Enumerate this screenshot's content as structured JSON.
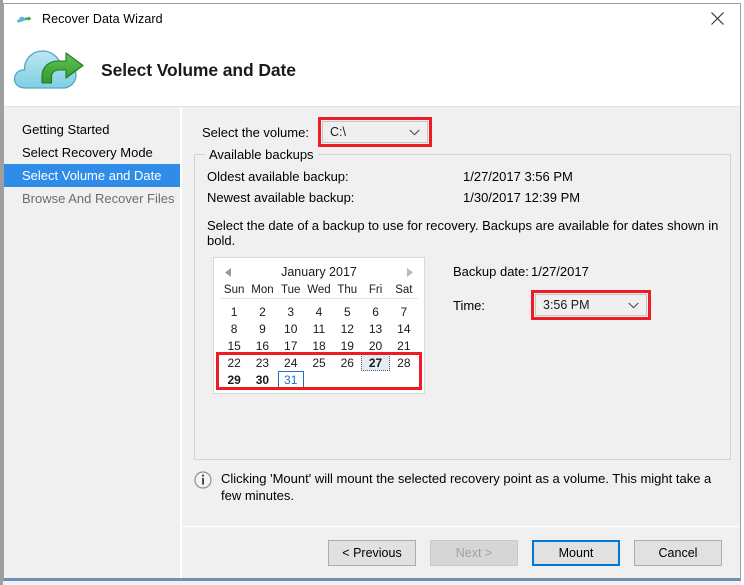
{
  "window": {
    "title": "Recover Data Wizard",
    "icon": "cloud-icon",
    "close_label": "×"
  },
  "banner": {
    "title": "Select Volume and Date",
    "icon": "cloud-recovery-icon"
  },
  "sidebar": {
    "items": [
      {
        "label": "Getting Started",
        "state": "normal"
      },
      {
        "label": "Select Recovery Mode",
        "state": "normal"
      },
      {
        "label": "Select Volume and Date",
        "state": "active"
      },
      {
        "label": "Browse And Recover Files",
        "state": "disabled"
      }
    ]
  },
  "volume": {
    "label": "Select the volume:",
    "selected": "C:\\",
    "options": [
      "C:\\"
    ],
    "highlight_color": "#ee1c25"
  },
  "available_backups": {
    "legend": "Available backups",
    "oldest_label": "Oldest available backup:",
    "oldest_value": "1/27/2017 3:56 PM",
    "newest_label": "Newest available backup:",
    "newest_value": "1/30/2017 12:39 PM",
    "instruction": "Select the date of a backup to use for recovery. Backups are available for dates shown in bold."
  },
  "calendar": {
    "month_title": "January 2017",
    "prev_arrow": "◄",
    "next_arrow": "►",
    "day_headers": [
      "Sun",
      "Mon",
      "Tue",
      "Wed",
      "Thu",
      "Fri",
      "Sat"
    ],
    "leading_blanks": 0,
    "days": [
      {
        "d": "1"
      },
      {
        "d": "2"
      },
      {
        "d": "3"
      },
      {
        "d": "4"
      },
      {
        "d": "5"
      },
      {
        "d": "6"
      },
      {
        "d": "7"
      },
      {
        "d": "8"
      },
      {
        "d": "9"
      },
      {
        "d": "10"
      },
      {
        "d": "11"
      },
      {
        "d": "12"
      },
      {
        "d": "13"
      },
      {
        "d": "14"
      },
      {
        "d": "15"
      },
      {
        "d": "16"
      },
      {
        "d": "17"
      },
      {
        "d": "18"
      },
      {
        "d": "19"
      },
      {
        "d": "20"
      },
      {
        "d": "21"
      },
      {
        "d": "22"
      },
      {
        "d": "23"
      },
      {
        "d": "24"
      },
      {
        "d": "25"
      },
      {
        "d": "26"
      },
      {
        "d": "27",
        "bold": true,
        "selected": true
      },
      {
        "d": "28"
      },
      {
        "d": "29",
        "bold": true
      },
      {
        "d": "30",
        "bold": true
      },
      {
        "d": "31",
        "today": true
      }
    ],
    "highlight_color": "#ee1c25"
  },
  "backup_date": {
    "label": "Backup date:",
    "value": "1/27/2017"
  },
  "time": {
    "label": "Time:",
    "selected": "3:56 PM",
    "options": [
      "3:56 PM"
    ],
    "highlight_color": "#ee1c25"
  },
  "note": {
    "icon": "info-icon",
    "text": "Clicking 'Mount' will mount the selected recovery point as a volume. This might take a few minutes."
  },
  "footer": {
    "previous_label": "< Previous",
    "next_label": "Next >",
    "mount_label": "Mount",
    "cancel_label": "Cancel",
    "default_button_color": "#0078d7"
  }
}
